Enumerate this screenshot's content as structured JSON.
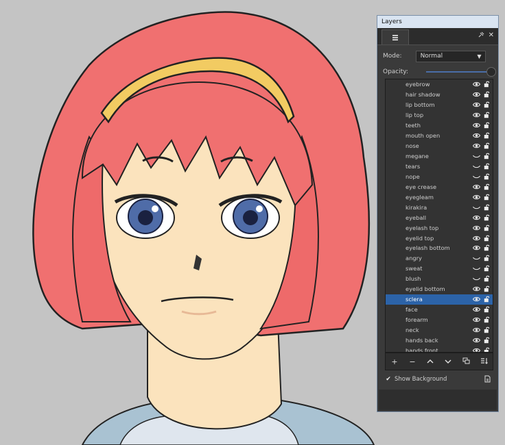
{
  "panel": {
    "title": "Layers",
    "mode_label": "Mode:",
    "mode_value": "Normal",
    "opacity_label": "Opacity:",
    "opacity_value": 1.0,
    "show_background_label": "Show Background",
    "show_background_checked": true
  },
  "layers": [
    {
      "name": "eyebrow",
      "visible": true,
      "selected": false
    },
    {
      "name": "hair shadow",
      "visible": true,
      "selected": false
    },
    {
      "name": "lip bottom",
      "visible": true,
      "selected": false
    },
    {
      "name": "lip top",
      "visible": true,
      "selected": false
    },
    {
      "name": "teeth",
      "visible": true,
      "selected": false
    },
    {
      "name": "mouth open",
      "visible": true,
      "selected": false
    },
    {
      "name": "nose",
      "visible": true,
      "selected": false
    },
    {
      "name": "megane",
      "visible": false,
      "selected": false
    },
    {
      "name": "tears",
      "visible": false,
      "selected": false
    },
    {
      "name": "nope",
      "visible": false,
      "selected": false
    },
    {
      "name": "eye crease",
      "visible": true,
      "selected": false
    },
    {
      "name": "eyegleam",
      "visible": true,
      "selected": false
    },
    {
      "name": "kirakira",
      "visible": false,
      "selected": false
    },
    {
      "name": "eyeball",
      "visible": true,
      "selected": false
    },
    {
      "name": "eyelash top",
      "visible": true,
      "selected": false
    },
    {
      "name": "eyelid top",
      "visible": true,
      "selected": false
    },
    {
      "name": "eyelash bottom",
      "visible": true,
      "selected": false
    },
    {
      "name": "angry",
      "visible": false,
      "selected": false
    },
    {
      "name": "sweat",
      "visible": false,
      "selected": false
    },
    {
      "name": "blush",
      "visible": false,
      "selected": false
    },
    {
      "name": "eyelid bottom",
      "visible": true,
      "selected": false
    },
    {
      "name": "sclera",
      "visible": true,
      "selected": true
    },
    {
      "name": "face",
      "visible": true,
      "selected": false
    },
    {
      "name": "forearm",
      "visible": true,
      "selected": false
    },
    {
      "name": "neck",
      "visible": true,
      "selected": false
    },
    {
      "name": "hands back",
      "visible": true,
      "selected": false
    },
    {
      "name": "hands front",
      "visible": true,
      "selected": false
    }
  ],
  "toolbar_buttons": [
    "add-layer",
    "remove-layer",
    "move-up",
    "move-down",
    "duplicate",
    "sort"
  ],
  "colors": {
    "background": "#c4c4c4",
    "hair": "#f07070",
    "headband": "#f2cb62",
    "skin": "#fbe3bd",
    "iris": "#4f6ca8",
    "panel": "#3a3a3a",
    "selection": "#2c63a8"
  }
}
